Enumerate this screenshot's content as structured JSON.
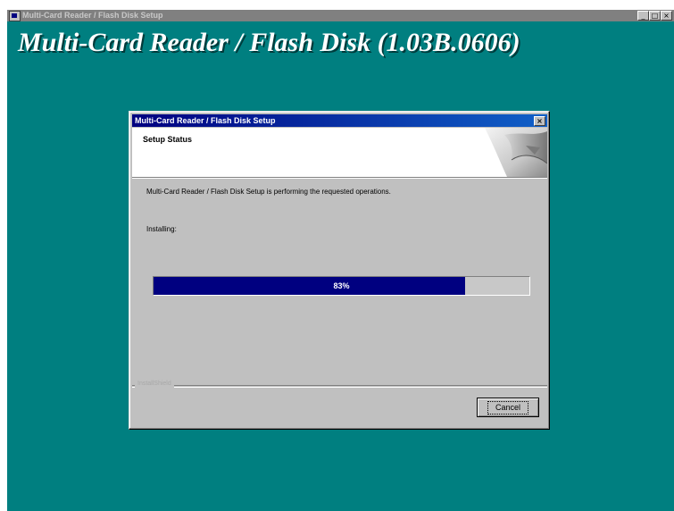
{
  "outer_window": {
    "title": "Multi-Card Reader / Flash Disk Setup",
    "banner": "Multi-Card Reader / Flash Disk (1.03B.0606)",
    "controls": {
      "minimize": "_",
      "maximize": "□",
      "close": "×"
    }
  },
  "dialog": {
    "title": "Multi-Card Reader / Flash Disk Setup",
    "close_label": "×",
    "header_title": "Setup Status",
    "message": "Multi-Card Reader / Flash Disk Setup is performing the requested operations.",
    "status_label": "Installing:",
    "progress": {
      "percent": 83,
      "text": "83%"
    },
    "footer_label": "InstallShield",
    "cancel_label": "Cancel"
  },
  "colors": {
    "desktop": "#007f80",
    "titlebar_start": "#000080",
    "titlebar_end": "#1060c8",
    "progress_fill": "#000080",
    "dialog_bg": "#c0c0c0"
  }
}
